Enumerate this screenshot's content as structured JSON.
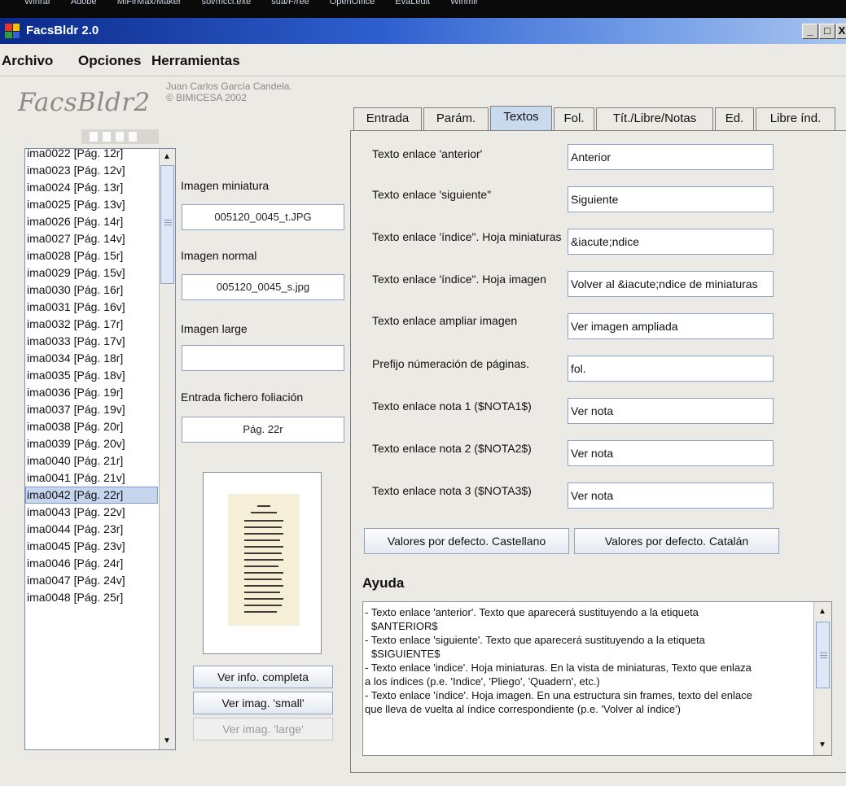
{
  "taskbar": {
    "items": [
      "Winrar",
      "Adobe",
      "MiFirMax/Maker",
      "sol/mccl.exe",
      "sua/F/ree",
      "OpenOffice",
      "EvaLedit",
      "Winmir"
    ]
  },
  "window": {
    "title": "FacsBldr 2.0",
    "controls": {
      "minimize": "_",
      "maximize": "□",
      "close": "X"
    }
  },
  "menu": {
    "archivo": "Archivo",
    "opciones": "Opciones",
    "herramientas": "Herramientas"
  },
  "branding": {
    "logo": "FacsBldr2",
    "author": "Juan Carlos García Candela.",
    "copyright": "© BIMICESA 2002"
  },
  "file_list": {
    "items": [
      "ima0022 [Pág. 12r]",
      "ima0023 [Pág. 12v]",
      "ima0024 [Pág. 13r]",
      "ima0025 [Pág. 13v]",
      "ima0026 [Pág. 14r]",
      "ima0027 [Pág. 14v]",
      "ima0028 [Pág. 15r]",
      "ima0029 [Pág. 15v]",
      "ima0030 [Pág. 16r]",
      "ima0031 [Pág. 16v]",
      "ima0032 [Pág. 17r]",
      "ima0033 [Pág. 17v]",
      "ima0034 [Pág. 18r]",
      "ima0035 [Pág. 18v]",
      "ima0036 [Pág. 19r]",
      "ima0037 [Pág. 19v]",
      "ima0038 [Pág. 20r]",
      "ima0039 [Pág. 20v]",
      "ima0040 [Pág. 21r]",
      "ima0041 [Pág. 21v]",
      "ima0042 [Pág. 22r]",
      "ima0043 [Pág. 22v]",
      "ima0044 [Pág. 23r]",
      "ima0045 [Pág. 23v]",
      "ima0046 [Pág. 24r]",
      "ima0047 [Pág. 24v]",
      "ima0048 [Pág. 25r]"
    ],
    "selected_index": 20
  },
  "image_info": {
    "miniatura_label": "Imagen miniatura",
    "miniatura_value": "005120_0045_t.JPG",
    "normal_label": "Imagen normal",
    "normal_value": "005120_0045_s.jpg",
    "large_label": "Imagen large",
    "large_value": "",
    "foliacion_label": "Entrada fichero foliación",
    "foliacion_value": "Pág. 22r"
  },
  "image_buttons": {
    "info": "Ver info. completa",
    "small": "Ver imag. 'small'",
    "large": "Ver imag. 'large'"
  },
  "tabs": [
    {
      "label": "Entrada"
    },
    {
      "label": "Parám."
    },
    {
      "label": "Textos"
    },
    {
      "label": "Fol."
    },
    {
      "label": "Tít./Libre/Notas"
    },
    {
      "label": "Ed."
    },
    {
      "label": "Libre índ."
    }
  ],
  "active_tab": "Textos",
  "textos": [
    {
      "label": "Texto enlace 'anterior'",
      "value": "Anterior"
    },
    {
      "label": "Texto enlace 'siguiente\"",
      "value": "Siguiente"
    },
    {
      "label": "Texto enlace 'índice\". Hoja miniaturas",
      "value": "&iacute;ndice"
    },
    {
      "label": "Texto enlace 'índice\". Hoja imagen",
      "value": "Volver al &iacute;ndice de miniaturas"
    },
    {
      "label": "Texto enlace ampliar imagen",
      "value": "Ver imagen ampliada"
    },
    {
      "label": "Prefijo númeración de páginas.",
      "value": "fol."
    },
    {
      "label": "Texto enlace nota 1 ($NOTA1$)",
      "value": "Ver nota"
    },
    {
      "label": "Texto enlace nota 2 ($NOTA2$)",
      "value": "Ver nota"
    },
    {
      "label": "Texto enlace nota 3 ($NOTA3$)",
      "value": "Ver nota"
    }
  ],
  "panel_buttons": {
    "castellano": "Valores por defecto. Castellano",
    "catalan": "Valores por defecto. Catalán"
  },
  "help": {
    "title": "Ayuda",
    "lines": [
      "- Texto enlace 'anterior'. Texto que aparecerá sustituyendo a la etiqueta",
      "  $ANTERIOR$",
      "- Texto enlace 'siguiente'. Texto que aparecerá sustituyendo a la etiqueta",
      "  $SIGUIENTE$",
      "- Texto enlace 'indice'. Hoja miniaturas. En la vista de miniaturas, Texto que enlaza",
      "  a los índices (p.e. 'Indice', 'Pliego', 'Quadern', etc.)",
      "- Texto enlace 'índice'. Hoja imagen. En una estructura sin frames, texto del enlace",
      "  que  lleva de vuelta al índice correspondiente (p.e. 'Volver al índice')"
    ]
  },
  "colors": {
    "titlebar_start": "#0b2a8a",
    "titlebar_end": "#a9c4ef",
    "selection": "#c5d6ee",
    "active_tab": "#c9d9ee",
    "panel_bg": "#eceae4"
  }
}
